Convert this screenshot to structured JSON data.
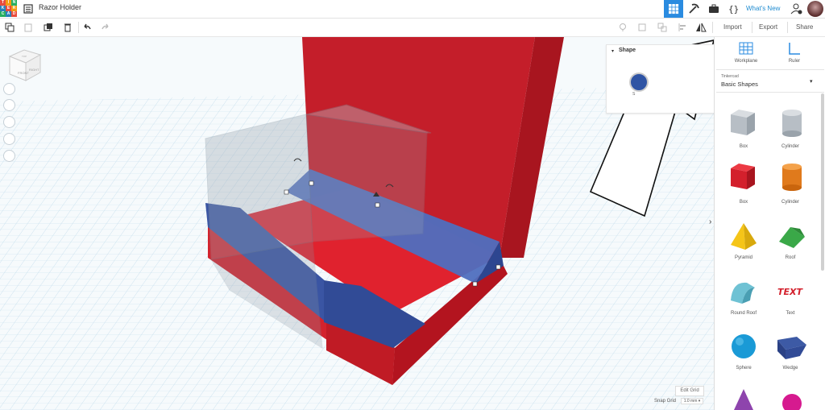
{
  "app": {
    "logo_letters": [
      "T",
      "I",
      "N",
      "K",
      "E",
      "R",
      "C",
      "A",
      "D"
    ],
    "title": "Razor Holder"
  },
  "topbar": {
    "whats_new": "What's New"
  },
  "toolbar": {
    "import_label": "Import",
    "export_label": "Export",
    "share_label": "Share"
  },
  "viewcube": {
    "face_label": "FRONT",
    "side_label": "RIGHT",
    "top_label": "TOP"
  },
  "shape_panel": {
    "title": "Shape",
    "partial_label": "S"
  },
  "right_panel": {
    "workplane_label": "Workplane",
    "ruler_label": "Ruler",
    "library_caption": "Tinkercad",
    "library_value": "Basic Shapes",
    "shapes": [
      {
        "label": "Box",
        "icon": "box-hole-icon"
      },
      {
        "label": "Cylinder",
        "icon": "cylinder-hole-icon"
      },
      {
        "label": "Box",
        "icon": "box-icon"
      },
      {
        "label": "Cylinder",
        "icon": "cylinder-icon"
      },
      {
        "label": "Pyramid",
        "icon": "pyramid-icon"
      },
      {
        "label": "Roof",
        "icon": "roof-icon"
      },
      {
        "label": "Round Roof",
        "icon": "round-roof-icon"
      },
      {
        "label": "Text",
        "icon": "text-shape-icon"
      },
      {
        "label": "Sphere",
        "icon": "sphere-icon"
      },
      {
        "label": "Wedge",
        "icon": "wedge-icon"
      }
    ],
    "text_shape_glyph": "TEXT"
  },
  "canvas": {
    "edit_grid_label": "Edit Grid",
    "snap_grid_label": "Snap Grid",
    "snap_grid_value": "1.0 mm"
  },
  "colors": {
    "accent": "#2a8be0",
    "red_shape": "#d9202c",
    "blue_shape": "#3d5aa5",
    "grid_bg": "#eaf4fa",
    "grid_line": "#bcd9ea"
  }
}
